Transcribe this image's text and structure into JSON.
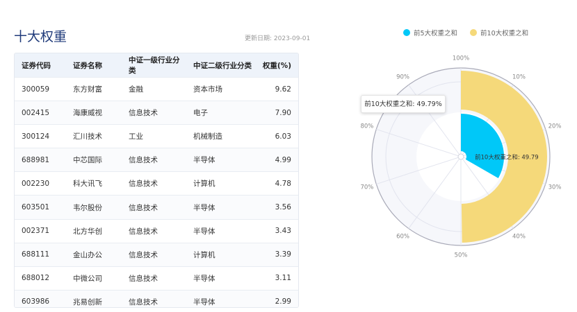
{
  "header": {
    "title": "十大权重",
    "updated": "更新日期: 2023-09-01"
  },
  "table": {
    "columns": [
      "证券代码",
      "证券名称",
      "中证一级行业分类",
      "中证二级行业分类",
      "权重(%)"
    ],
    "rows": [
      [
        "300059",
        "东方财富",
        "金融",
        "资本市场",
        "9.62"
      ],
      [
        "002415",
        "海康威视",
        "信息技术",
        "电子",
        "7.90"
      ],
      [
        "300124",
        "汇川技术",
        "工业",
        "机械制造",
        "6.03"
      ],
      [
        "688981",
        "中芯国际",
        "信息技术",
        "半导体",
        "4.99"
      ],
      [
        "002230",
        "科大讯飞",
        "信息技术",
        "计算机",
        "4.78"
      ],
      [
        "603501",
        "韦尔股份",
        "信息技术",
        "半导体",
        "3.56"
      ],
      [
        "002371",
        "北方华创",
        "信息技术",
        "半导体",
        "3.43"
      ],
      [
        "688111",
        "金山办公",
        "信息技术",
        "计算机",
        "3.39"
      ],
      [
        "688012",
        "中微公司",
        "信息技术",
        "半导体",
        "3.11"
      ],
      [
        "603986",
        "兆易创新",
        "信息技术",
        "半导体",
        "2.99"
      ]
    ]
  },
  "chart_data": {
    "type": "polar-bar",
    "angle_axis": {
      "min": 0,
      "max": 100,
      "ticks": [
        "100%",
        "10%",
        "20%",
        "30%",
        "40%",
        "50%",
        "60%",
        "70%",
        "80%",
        "90%"
      ]
    },
    "series": [
      {
        "name": "前5大权重之和",
        "value": 33.32,
        "color": "#00c8f8"
      },
      {
        "name": "前10大权重之和",
        "value": 49.79,
        "color": "#f5d97a"
      }
    ],
    "bar_label": "前10大权重之和: 49.79",
    "tooltip": "前10大权重之和: 49.79%",
    "legend_position": "top"
  }
}
